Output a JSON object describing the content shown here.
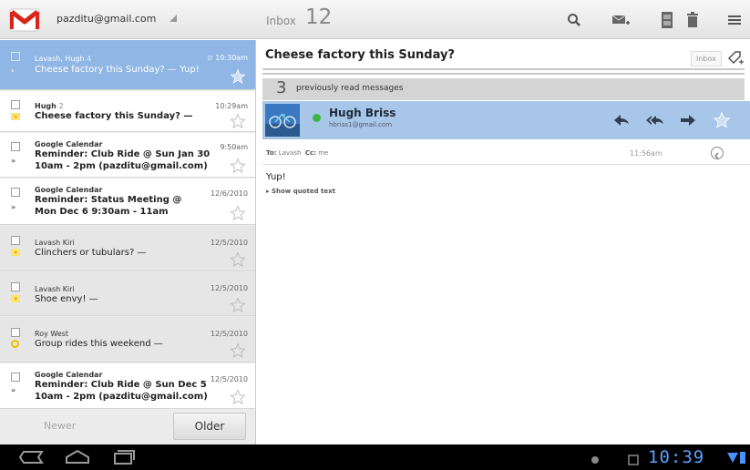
{
  "account": {
    "email": "pazditu@gmail.com"
  },
  "folder": {
    "name": "Inbox",
    "count": "12"
  },
  "actions": [
    "search-icon",
    "compose-icon",
    "archive-icon",
    "delete-icon",
    "menu-icon"
  ],
  "messages": [
    {
      "sender": "Lavash, Hugh",
      "thread_count": "4",
      "subject": "Cheese factory this Sunday? — Yup!",
      "time": "10:30am",
      "has_attachment": true,
      "state": "selected",
      "indicator": "›"
    },
    {
      "sender": "Hugh",
      "thread_count": "2",
      "subject": "Cheese factory this Sunday? —",
      "time": "10:29am",
      "state": "unread",
      "indicator": "»"
    },
    {
      "sender": "Google Calendar",
      "subject_line1": "Reminder: Club Ride @ Sun Jan 30",
      "subject_line2": "10am - 2pm (pazditu@gmail.com)",
      "time": "9:50am",
      "state": "unread",
      "indicator": "»"
    },
    {
      "sender": "Google Calendar",
      "subject_line1": "Reminder: Status Meeting @",
      "subject_line2": "Mon Dec 6 9:30am - 11am",
      "time": "12/6/2010",
      "state": "unread",
      "indicator": "»"
    },
    {
      "sender": "Lavash Kiri",
      "subject": "Clinchers or tubulars? —",
      "time": "12/5/2010",
      "state": "read",
      "indicator": "»"
    },
    {
      "sender": "Lavash Kiri",
      "subject": "Shoe envy! —",
      "time": "12/5/2010",
      "state": "read",
      "indicator": "»"
    },
    {
      "sender": "Roy West",
      "subject": "Group rides this weekend —",
      "time": "12/5/2010",
      "state": "read",
      "indicator": "›"
    },
    {
      "sender": "Google Calendar",
      "subject_line1": "Reminder: Club Ride @ Sun Dec 5",
      "subject_line2": "10am - 2pm (pazditu@gmail.com)",
      "time": "12/5/2010",
      "state": "unread",
      "indicator": "»"
    }
  ],
  "pager": {
    "newer": "Newer",
    "older": "Older"
  },
  "conversation": {
    "subject": "Cheese factory this Sunday?",
    "label": "Inbox",
    "previously_read_count": "3",
    "previously_read_text": "previously read messages",
    "from_name": "Hugh Briss",
    "from_email": "hbriss1@gmail.com",
    "to_label": "To:",
    "to_value": "Lavash",
    "cc_label": "Cc:",
    "cc_value": "me",
    "time": "11:56am",
    "body": "Yup!",
    "show_quoted": "▸ Show quoted text"
  },
  "status": {
    "clock": "10:39"
  },
  "colors": {
    "selected_row": "#8fb6e4",
    "header_bar": "#a8c7e8",
    "system_bar": "#000000",
    "clock": "#5aa0ff"
  }
}
